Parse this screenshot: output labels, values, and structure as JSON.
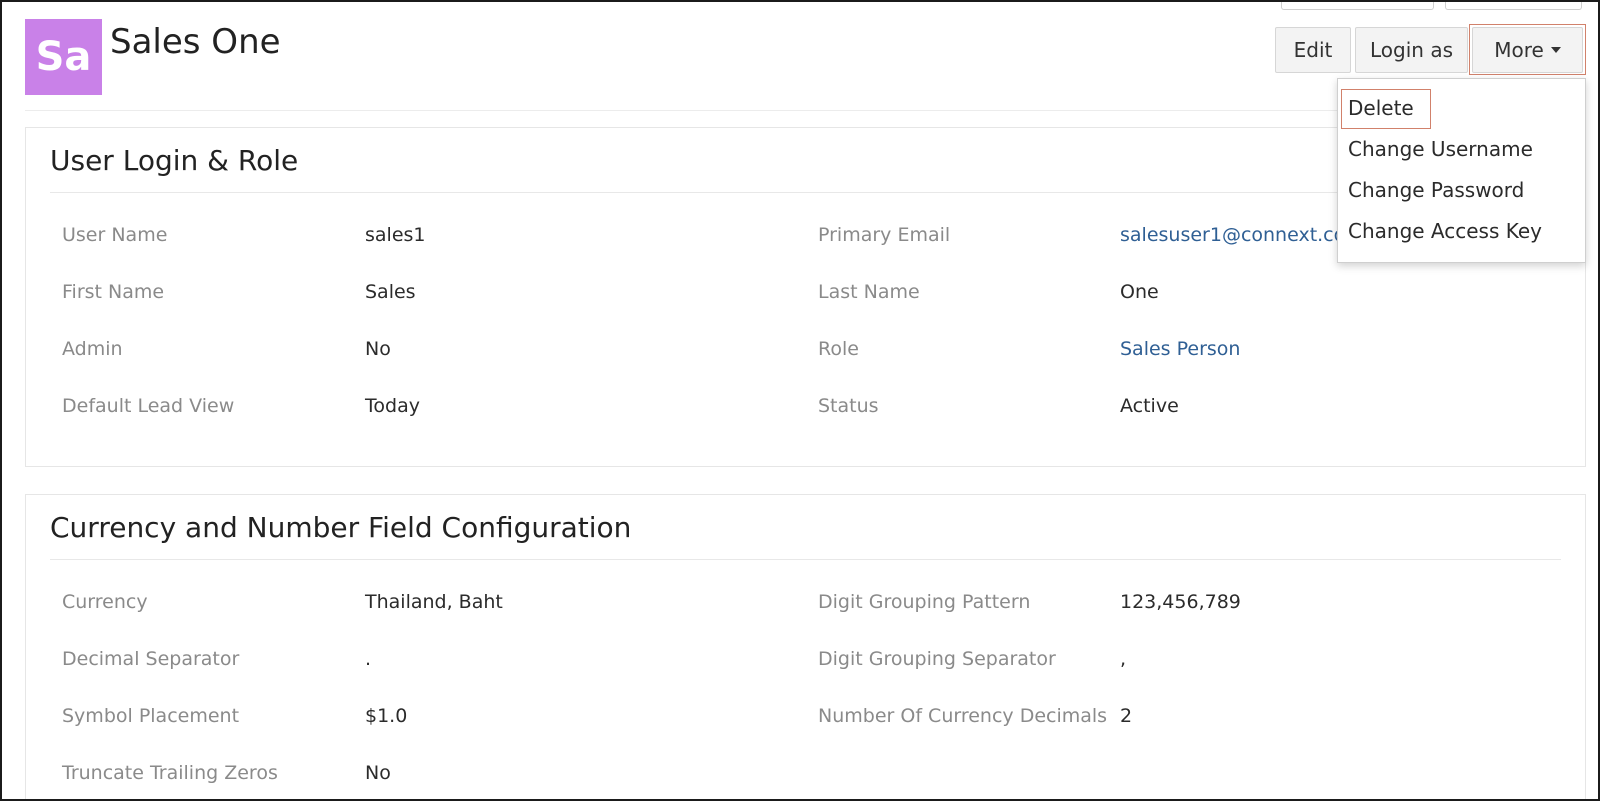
{
  "header": {
    "avatar_initials": "Sa",
    "avatar_color": "#c981e8",
    "title": "Sales One"
  },
  "actions": {
    "edit_label": "Edit",
    "login_as_label": "Login as",
    "more_label": "More"
  },
  "more_menu": {
    "items": [
      "Delete",
      "Change Username",
      "Change Password",
      "Change Access Key"
    ]
  },
  "user_login_role": {
    "title": "User Login & Role",
    "fields": [
      {
        "label": "User Name",
        "value": "sales1"
      },
      {
        "label": "Primary Email",
        "value": "salesuser1@connext.com"
      },
      {
        "label": "First Name",
        "value": "Sales"
      },
      {
        "label": "Last Name",
        "value": "One"
      },
      {
        "label": "Admin",
        "value": "No"
      },
      {
        "label": "Role",
        "value": "Sales Person"
      },
      {
        "label": "Default Lead View",
        "value": "Today"
      },
      {
        "label": "Status",
        "value": "Active"
      }
    ]
  },
  "currency_config": {
    "title": "Currency and Number Field Configuration",
    "fields": [
      {
        "label": "Currency",
        "value": "Thailand, Baht"
      },
      {
        "label": "Digit Grouping Pattern",
        "value": "123,456,789"
      },
      {
        "label": "Decimal Separator",
        "value": "."
      },
      {
        "label": "Digit Grouping Separator",
        "value": ","
      },
      {
        "label": "Symbol Placement",
        "value": "$1.0"
      },
      {
        "label": "Number Of Currency Decimals",
        "value": "2"
      },
      {
        "label": "Truncate Trailing Zeros",
        "value": "No"
      }
    ]
  },
  "colors": {
    "link": "#2f5f94",
    "highlight": "#d1816b"
  }
}
